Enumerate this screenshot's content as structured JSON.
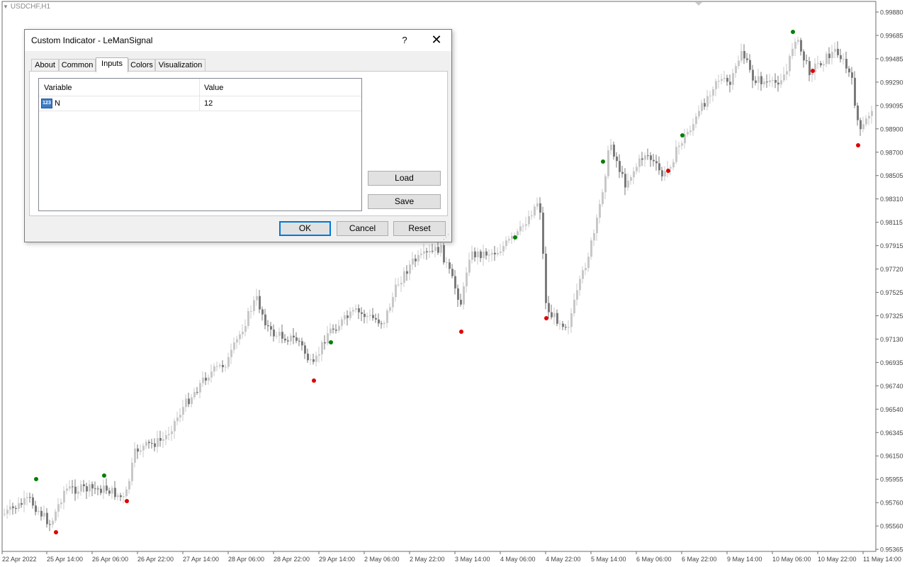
{
  "chart": {
    "symbol": "USDCHF,H1",
    "price_levels": [
      "0.99880",
      "0.99685",
      "0.99485",
      "0.99290",
      "0.99095",
      "0.98900",
      "0.98700",
      "0.98505",
      "0.98310",
      "0.98115",
      "0.97915",
      "0.97720",
      "0.97525",
      "0.97325",
      "0.97130",
      "0.96935",
      "0.96740",
      "0.96540",
      "0.96345",
      "0.96150",
      "0.95955",
      "0.95760",
      "0.95560",
      "0.95365"
    ],
    "time_labels": [
      "22 Apr 2022",
      "25 Apr 14:00",
      "26 Apr 06:00",
      "26 Apr 22:00",
      "27 Apr 14:00",
      "28 Apr 06:00",
      "28 Apr 22:00",
      "29 Apr 14:00",
      "2 May 06:00",
      "2 May 22:00",
      "3 May 14:00",
      "4 May 06:00",
      "4 May 22:00",
      "5 May 14:00",
      "6 May 06:00",
      "6 May 22:00",
      "9 May 14:00",
      "10 May 06:00",
      "10 May 22:00",
      "11 May 14:00"
    ],
    "colors": {
      "bull_candle": "#c8c8c8",
      "bear_candle": "#7a7a7a",
      "buy_signal": "#008000",
      "sell_signal": "#e00000",
      "axis": "#6e6e6e"
    }
  },
  "dialog": {
    "title": "Custom Indicator - LeManSignal",
    "help_label": "?",
    "close_label": "✕",
    "tabs": [
      {
        "label": "About",
        "active": false
      },
      {
        "label": "Common",
        "active": false
      },
      {
        "label": "Inputs",
        "active": true
      },
      {
        "label": "Colors",
        "active": false
      },
      {
        "label": "Visualization",
        "active": false
      }
    ],
    "grid": {
      "col_variable": "Variable",
      "col_value": "Value",
      "rows": [
        {
          "type_icon": "123",
          "variable": "N",
          "value": "12"
        }
      ]
    },
    "buttons": {
      "load": "Load",
      "save": "Save",
      "ok": "OK",
      "cancel": "Cancel",
      "reset": "Reset"
    }
  }
}
